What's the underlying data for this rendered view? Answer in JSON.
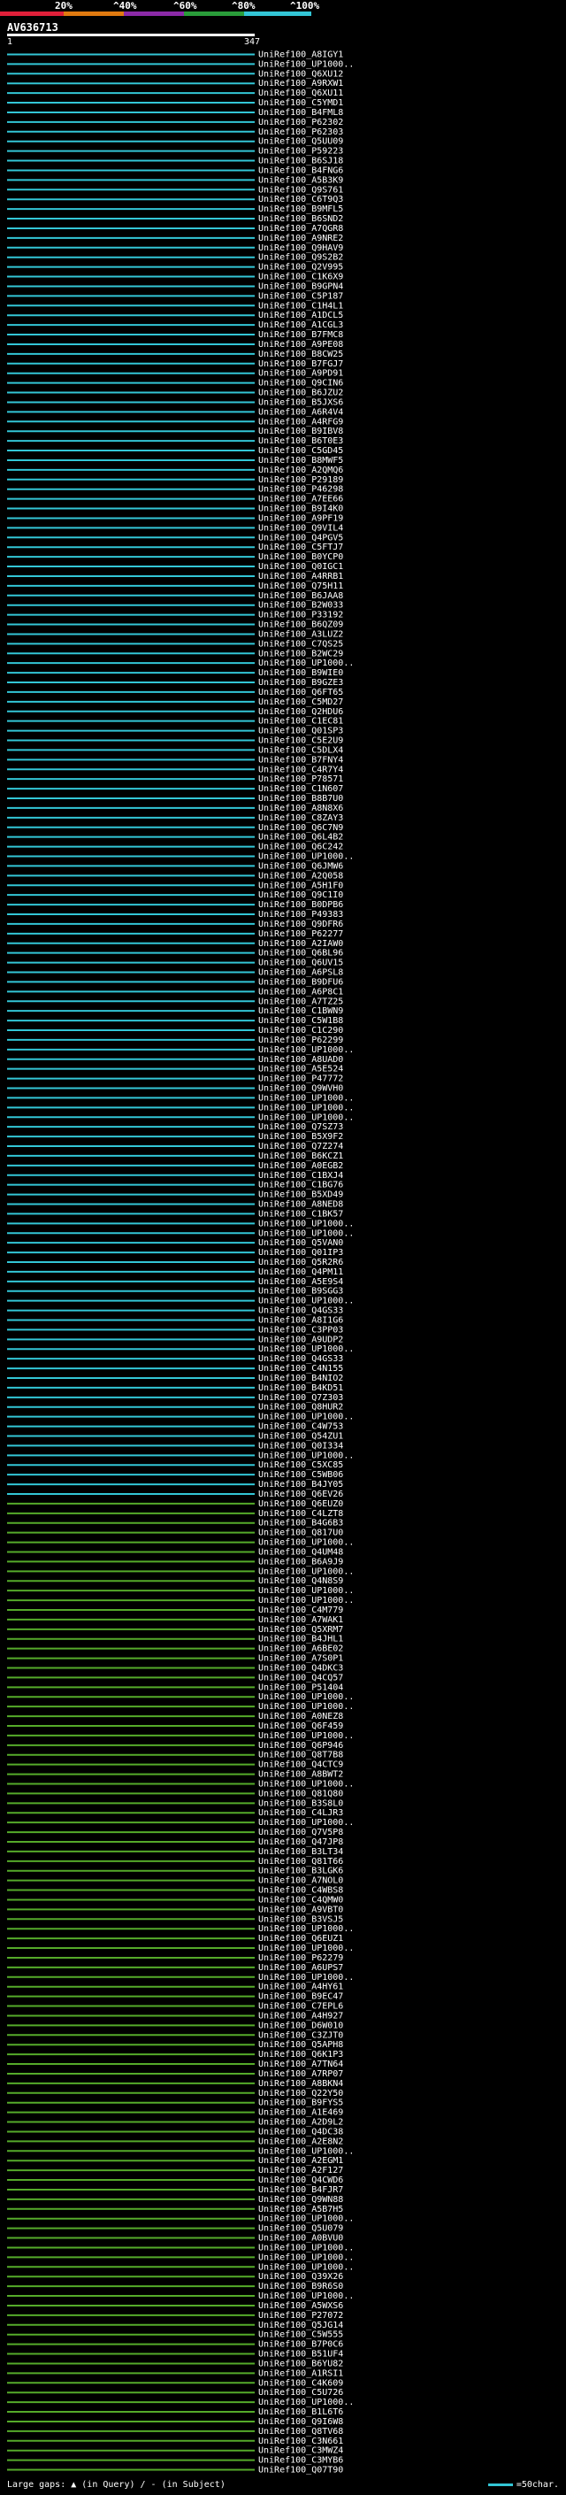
{
  "legend": {
    "ticks": [
      "20%",
      "^40%",
      "^60%",
      "^80%",
      "^100%"
    ],
    "colors": [
      "#e0203a",
      "#e07a10",
      "#8c2aa8",
      "#2a9d3a",
      "#33c6d6"
    ]
  },
  "query": {
    "name": "AV636713",
    "start_label": "1",
    "end_label": "347"
  },
  "footer": {
    "large_gaps": "Large gaps: ▲ (in Query) / - (in Subject)",
    "scale": "=50char."
  },
  "chart_data": {
    "type": "alignment",
    "query_length": 347,
    "identity_colors": {
      "cyan": "#33c6d6",
      "green": "#55aa2a",
      "purple": "#8c2aa8"
    },
    "hits": [
      "UniRef100_A8IGY1",
      "UniRef100_UP1000..",
      "UniRef100_Q6XU12",
      "UniRef100_A9RXW1",
      "UniRef100_Q6XU11",
      "UniRef100_C5YMD1",
      "UniRef100_B4FML8",
      "UniRef100_P62302",
      "UniRef100_P62303",
      "UniRef100_Q5UU09",
      "UniRef100_P59223",
      "UniRef100_B6SJ18",
      "UniRef100_B4FNG6",
      "UniRef100_A5B3K9",
      "UniRef100_Q9S761",
      "UniRef100_C6T9Q3",
      "UniRef100_B9MFL5",
      "UniRef100_B6SND2",
      "UniRef100_A7QGR8",
      "UniRef100_A9NRE2",
      "UniRef100_Q9HAV9",
      "UniRef100_Q9S2B2",
      "UniRef100_Q2V995",
      "UniRef100_C1K6X9",
      "UniRef100_B9GPN4",
      "UniRef100_C5P187",
      "UniRef100_C1H4L1",
      "UniRef100_A1DCL5",
      "UniRef100_A1CGL3",
      "UniRef100_B7FMC8",
      "UniRef100_A9PE08",
      "UniRef100_B8CW25",
      "UniRef100_B7FGJ7",
      "UniRef100_A9PD91",
      "UniRef100_Q9CIN6",
      "UniRef100_B6JZU2",
      "UniRef100_B5JXS6",
      "UniRef100_A6R4V4",
      "UniRef100_A4RFG9",
      "UniRef100_B9IBV8",
      "UniRef100_B6T0E3",
      "UniRef100_C5GD45",
      "UniRef100_B8MWF5",
      "UniRef100_A2QMQ6",
      "UniRef100_P29189",
      "UniRef100_P46298",
      "UniRef100_A7EE66",
      "UniRef100_B9I4K0",
      "UniRef100_A9PF19",
      "UniRef100_Q9VIL4",
      "UniRef100_Q4PGV5",
      "UniRef100_C5FTJ7",
      "UniRef100_B0YCP0",
      "UniRef100_Q0IGC1",
      "UniRef100_A4RRB1",
      "UniRef100_Q75H11",
      "UniRef100_B6JAA8",
      "UniRef100_B2W033",
      "UniRef100_P33192",
      "UniRef100_B6QZ09",
      "UniRef100_A3LUZ2",
      "UniRef100_C7QS25",
      "UniRef100_B2WC29",
      "UniRef100_UP1000..",
      "UniRef100_B9WIE0",
      "UniRef100_B9GZE3",
      "UniRef100_Q6FT65",
      "UniRef100_C5MD27",
      "UniRef100_Q2HDU6",
      "UniRef100_C1EC81",
      "UniRef100_Q01SP3",
      "UniRef100_C5E2U9",
      "UniRef100_C5DLX4",
      "UniRef100_B7FNY4",
      "UniRef100_C4R7Y4",
      "UniRef100_P78571",
      "UniRef100_C1N607",
      "UniRef100_B8B7U0",
      "UniRef100_A8N8X6",
      "UniRef100_C8ZAY3",
      "UniRef100_Q6C7N9",
      "UniRef100_Q6L4B2",
      "UniRef100_Q6C242",
      "UniRef100_UP1000..",
      "UniRef100_Q6JMW6",
      "UniRef100_A2Q058",
      "UniRef100_A5H1F0",
      "UniRef100_Q9C1I0",
      "UniRef100_B0DPB6",
      "UniRef100_P49383",
      "UniRef100_Q9DFR6",
      "UniRef100_P62277",
      "UniRef100_A2IAW0",
      "UniRef100_Q6BL96",
      "UniRef100_Q6UV15",
      "UniRef100_A6PSL8",
      "UniRef100_B9DFU6",
      "UniRef100_A6P8C1",
      "UniRef100_A7TZ25",
      "UniRef100_C1BWN9",
      "UniRef100_C5W1B8",
      "UniRef100_C1C290",
      "UniRef100_P62299",
      "UniRef100_UP1000..",
      "UniRef100_A8UAD0",
      "UniRef100_A5E524",
      "UniRef100_P47772",
      "UniRef100_Q9WVH0",
      "UniRef100_UP1000..",
      "UniRef100_UP1000..",
      "UniRef100_UP1000..",
      "UniRef100_Q7SZ73",
      "UniRef100_B5X9F2",
      "UniRef100_Q7Z274",
      "UniRef100_B6KCZ1",
      "UniRef100_A0EGB2",
      "UniRef100_C1BXJ4",
      "UniRef100_C1BG76",
      "UniRef100_B5XD49",
      "UniRef100_A8NED8",
      "UniRef100_C1BK57",
      "UniRef100_UP1000..",
      "UniRef100_UP1000..",
      "UniRef100_Q5VAN0",
      "UniRef100_Q01IP3",
      "UniRef100_Q5R2R6",
      "UniRef100_Q4PM11",
      "UniRef100_A5E9S4",
      "UniRef100_B9SGG3",
      "UniRef100_UP1000..",
      "UniRef100_Q4GS33",
      "UniRef100_A8I1G6",
      "UniRef100_C3PP03",
      "UniRef100_A9UDP2",
      "UniRef100_UP1000..",
      "UniRef100_Q4GS33",
      "UniRef100_C4N155",
      "UniRef100_B4NIO2",
      "UniRef100_B4KD51",
      "UniRef100_Q7Z303",
      "UniRef100_Q8HUR2",
      "UniRef100_UP1000..",
      "UniRef100_C4W753",
      "UniRef100_Q54ZU1",
      "UniRef100_Q0I334",
      "UniRef100_UP1000..",
      "UniRef100_C5XC85",
      "UniRef100_C5WB06",
      "UniRef100_B4JY05",
      "UniRef100_Q6EV26",
      "UniRef100_Q6EUZ0",
      "UniRef100_C4LZT8",
      "UniRef100_B4G6B3",
      "UniRef100_Q817U0",
      "UniRef100_UP1000..",
      "UniRef100_Q4UM48",
      "UniRef100_B6A9J9",
      "UniRef100_UP1000..",
      "UniRef100_Q4N8S9",
      "UniRef100_UP1000..",
      "UniRef100_UP1000..",
      "UniRef100_C4M779",
      "UniRef100_A7WAK1",
      "UniRef100_Q5XRM7",
      "UniRef100_B4JHL1",
      "UniRef100_A6BE02",
      "UniRef100_A7S0P1",
      "UniRef100_Q4DKC3",
      "UniRef100_Q4CQ57",
      "UniRef100_P51404",
      "UniRef100_UP1000..",
      "UniRef100_UP1000..",
      "UniRef100_A0NEZ8",
      "UniRef100_Q6F459",
      "UniRef100_UP1000..",
      "UniRef100_Q6P946",
      "UniRef100_Q8T7B8",
      "UniRef100_Q4CTC9",
      "UniRef100_A8BWT2",
      "UniRef100_UP1000..",
      "UniRef100_Q81Q80",
      "UniRef100_B3S8L0",
      "UniRef100_C4LJR3",
      "UniRef100_UP1000..",
      "UniRef100_Q7V5P8",
      "UniRef100_Q47JP8",
      "UniRef100_B3LT34",
      "UniRef100_Q81T66",
      "UniRef100_B3LGK6",
      "UniRef100_A7NOL0",
      "UniRef100_C4WBS8",
      "UniRef100_C4QMW0",
      "UniRef100_A9VBT0",
      "UniRef100_B3VSJ5",
      "UniRef100_UP1000..",
      "UniRef100_Q6EUZ1",
      "UniRef100_UP1000..",
      "UniRef100_P62279",
      "UniRef100_A6UPS7",
      "UniRef100_UP1000..",
      "UniRef100_A4HY61",
      "UniRef100_B9EC47",
      "UniRef100_C7EPL6",
      "UniRef100_A4H927",
      "UniRef100_D6W010",
      "UniRef100_C3ZJT0",
      "UniRef100_Q5APH8",
      "UniRef100_Q6K1P3",
      "UniRef100_A7TN64",
      "UniRef100_A7RP07",
      "UniRef100_A8BKN4",
      "UniRef100_Q22Y50",
      "UniRef100_B9FYS5",
      "UniRef100_A1E469",
      "UniRef100_A2D9L2",
      "UniRef100_Q4DC38",
      "UniRef100_A2E8N2",
      "UniRef100_UP1000..",
      "UniRef100_A2EGM1",
      "UniRef100_A2F127",
      "UniRef100_Q4CWD6",
      "UniRef100_B4FJR7",
      "UniRef100_Q9WN88",
      "UniRef100_A5B7H5",
      "UniRef100_UP1000..",
      "UniRef100_Q5U079",
      "UniRef100_A0BVU0",
      "UniRef100_UP1000..",
      "UniRef100_UP1000..",
      "UniRef100_UP1000..",
      "UniRef100_Q39X26",
      "UniRef100_B9R6S0",
      "UniRef100_UP1000..",
      "UniRef100_A5WXS6",
      "UniRef100_P27072",
      "UniRef100_Q5JG14",
      "UniRef100_C5W555",
      "UniRef100_B7P0C6",
      "UniRef100_B51UF4",
      "UniRef100_B6YU82",
      "UniRef100_A1RSI1",
      "UniRef100_C4K609",
      "UniRef100_C5U726",
      "UniRef100_UP1000..",
      "UniRef100_B1L6T6",
      "UniRef100_Q9I6W8",
      "UniRef100_Q8TV68",
      "UniRef100_C3N661",
      "UniRef100_C3MWZ4",
      "UniRef100_C3MYB6",
      "UniRef100_Q07T90"
    ]
  }
}
